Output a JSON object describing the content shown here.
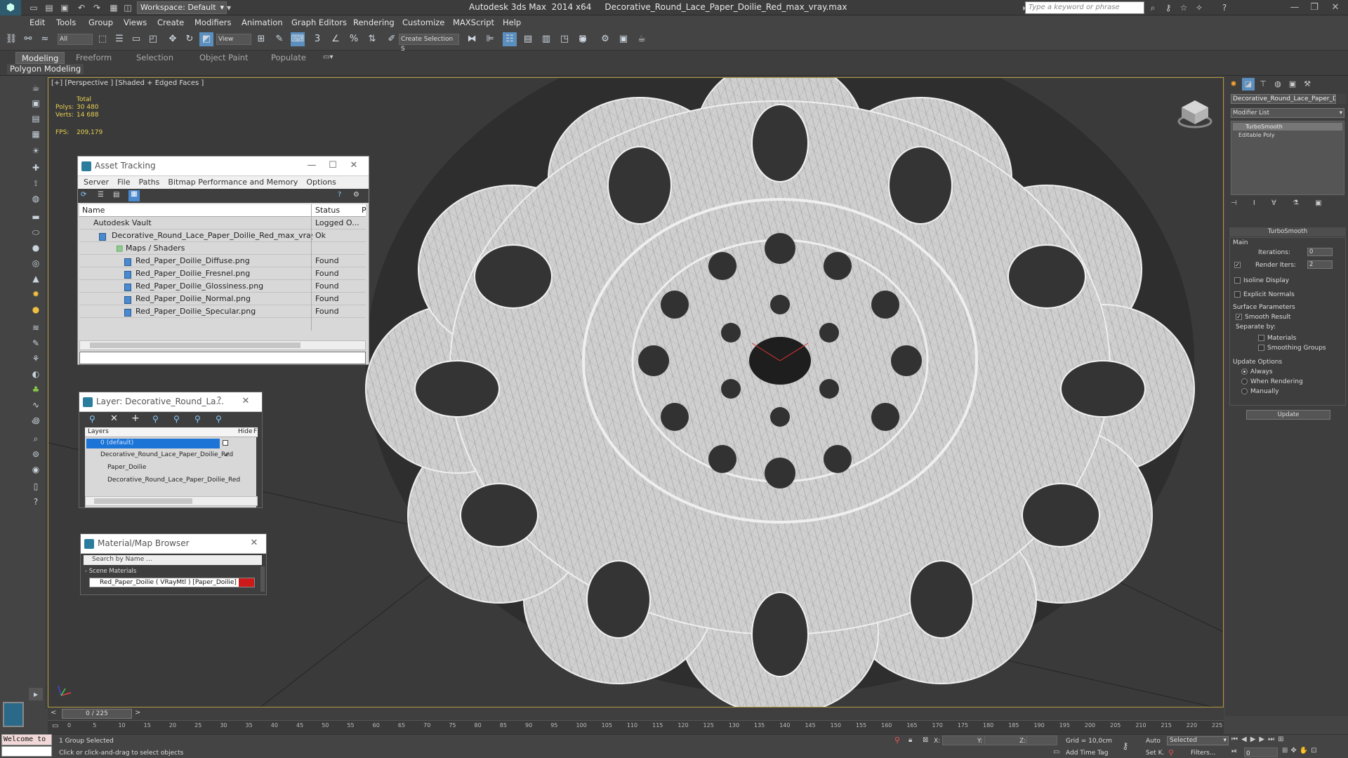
{
  "titlebar": {
    "app_title": "Autodesk 3ds Max  2014 x64     Decorative_Round_Lace_Paper_Doilie_Red_max_vray.max",
    "workspace_label": "Workspace: Default",
    "search_placeholder": "Type a keyword or phrase"
  },
  "menu": {
    "items": [
      "Edit",
      "Tools",
      "Group",
      "Views",
      "Create",
      "Modifiers",
      "Animation",
      "Graph Editors",
      "Rendering",
      "Customize",
      "MAXScript",
      "Help"
    ]
  },
  "toolbar": {
    "selection_filter": "All",
    "ref_coord": "View",
    "named_selection": "Create Selection S"
  },
  "ribbon": {
    "tabs": [
      "Modeling",
      "Freeform",
      "Selection",
      "Object Paint",
      "Populate"
    ],
    "active_tab": "Modeling",
    "subpanel": "Polygon Modeling"
  },
  "viewport": {
    "label": "[+] [Perspective ] [Shaded + Edged Faces ]",
    "stats_total": "Total",
    "polys_label": "Polys:",
    "polys_value": "30 480",
    "verts_label": "Verts:",
    "verts_value": "14 688",
    "fps_label": "FPS:",
    "fps_value": "209,179"
  },
  "asset_tracking": {
    "title": "Asset Tracking",
    "menu": [
      "Server",
      "File",
      "Paths",
      "Bitmap Performance and Memory",
      "Options"
    ],
    "col_name": "Name",
    "col_status": "Status",
    "col_p": "P",
    "rows": [
      {
        "name": "Autodesk Vault",
        "status": "Logged O..."
      },
      {
        "name": "Decorative_Round_Lace_Paper_Doilie_Red_max_vray.max",
        "status": "Ok"
      },
      {
        "name": "Maps / Shaders",
        "status": ""
      },
      {
        "name": "Red_Paper_Doilie_Diffuse.png",
        "status": "Found"
      },
      {
        "name": "Red_Paper_Doilie_Fresnel.png",
        "status": "Found"
      },
      {
        "name": "Red_Paper_Doilie_Glossiness.png",
        "status": "Found"
      },
      {
        "name": "Red_Paper_Doilie_Normal.png",
        "status": "Found"
      },
      {
        "name": "Red_Paper_Doilie_Specular.png",
        "status": "Found"
      }
    ]
  },
  "layer_window": {
    "title": "Layer: Decorative_Round_La...",
    "help": "?",
    "col_layers": "Layers",
    "col_hide": "Hide",
    "col_f": "F",
    "rows": [
      {
        "name": "0 (default)"
      },
      {
        "name": "Decorative_Round_Lace_Paper_Doilie_Red"
      },
      {
        "name": "Paper_Doilie"
      },
      {
        "name": "Decorative_Round_Lace_Paper_Doilie_Red"
      }
    ]
  },
  "material_browser": {
    "title": "Material/Map Browser",
    "search_placeholder": "Search by Name ...",
    "section": "- Scene Materials",
    "material": "Red_Paper_Doilie  ( VRayMtl )  [Paper_Doilie]",
    "swatch_color": "#cc1a1a"
  },
  "command_panel": {
    "object_name": "Decorative_Round_Lace_Paper_D",
    "modifier_list": "Modifier List",
    "stack": [
      "TurboSmooth",
      "Editable Poly"
    ],
    "rollout_title": "TurboSmooth",
    "main_label": "Main",
    "iterations_label": "Iterations:",
    "iterations_value": "0",
    "render_iters_label": "Render Iters:",
    "render_iters_value": "2",
    "isoline": "Isoline Display",
    "explicit_normals": "Explicit Normals",
    "surface_params": "Surface Parameters",
    "smooth_result": "Smooth Result",
    "separate_by": "Separate by:",
    "materials": "Materials",
    "smoothing_groups": "Smoothing Groups",
    "update_options": "Update Options",
    "always": "Always",
    "when_rendering": "When Rendering",
    "manually": "Manually",
    "update_button": "Update"
  },
  "timeline": {
    "frame": "0 / 225",
    "ticks": [
      "0",
      "5",
      "10",
      "15",
      "20",
      "25",
      "30",
      "35",
      "40",
      "45",
      "50",
      "55",
      "60",
      "65",
      "70",
      "75",
      "80",
      "85",
      "90",
      "95",
      "100",
      "105",
      "110",
      "115",
      "120",
      "125",
      "130",
      "135",
      "140",
      "145",
      "150",
      "155",
      "160",
      "165",
      "170",
      "175",
      "180",
      "185",
      "190",
      "195",
      "200",
      "205",
      "210",
      "215",
      "220",
      "225"
    ]
  },
  "statusbar": {
    "maxscript": "Welcome to",
    "selected_text": "1 Group Selected",
    "prompt_text": "Click or click-and-drag to select objects",
    "x_label": "X:",
    "y_label": "Y:",
    "z_label": "Z:",
    "grid": "Grid = 10,0cm",
    "add_time_tag": "Add Time Tag",
    "auto": "Auto",
    "set_key": "Set K.",
    "selected_dropdown": "Selected",
    "filters": "Filters...",
    "frame_field": "0"
  }
}
